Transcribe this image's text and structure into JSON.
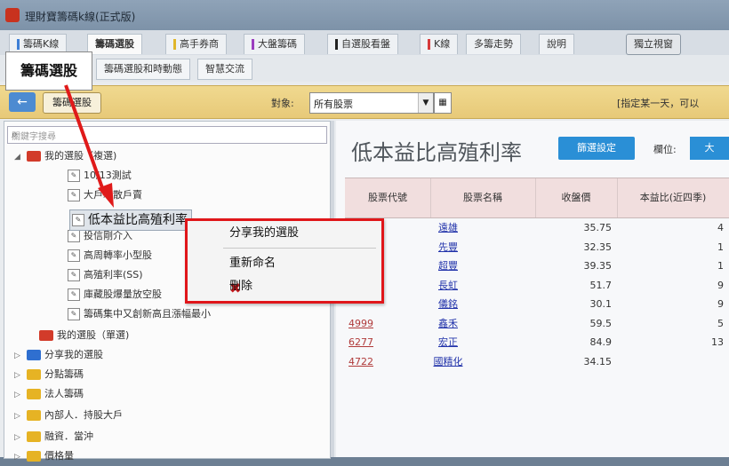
{
  "window": {
    "title": "理財寶籌碼k線(正式版)"
  },
  "tabs": [
    {
      "label": "籌碼K線",
      "mark": "#3f7fd6"
    },
    {
      "label": "籌碼選股",
      "mark": ""
    },
    {
      "label": "高手券商",
      "mark": "#e0b62a"
    },
    {
      "label": "大盤籌碼",
      "mark": "#9b3fbf"
    },
    {
      "label": "自選股看盤",
      "mark": "#222222"
    },
    {
      "label": "K線",
      "mark": "#d63a3a"
    },
    {
      "label": "多籌走勢",
      "mark": ""
    },
    {
      "label": "說明",
      "mark": ""
    },
    {
      "label": "獨立視窗",
      "mark": ""
    }
  ],
  "subtabs": [
    "籌碼選股和時動態",
    "智慧交流"
  ],
  "toolbar": {
    "back": "←",
    "stock_button": "籌碼選股",
    "object_label": "對象:",
    "object_value": "所有股票",
    "hint": "[指定某一天，可以"
  },
  "annotation": {
    "label": "籌碼選股"
  },
  "search": {
    "placeholder": "關鍵字搜尋",
    "icon": "search-icon"
  },
  "tree": [
    {
      "label": "我的選股（複選)",
      "type": "folder",
      "color": "#d23b2a",
      "arrow": "◢",
      "level": 0
    },
    {
      "label": "10/13測試",
      "type": "doc",
      "level": 1
    },
    {
      "label": "大戶增散戶賣",
      "type": "doc",
      "level": 1
    },
    {
      "label": "",
      "type": "spacer",
      "level": 1
    },
    {
      "label": "投信剛介入",
      "type": "doc",
      "level": 1
    },
    {
      "label": "高周轉率小型股",
      "type": "doc",
      "level": 1
    },
    {
      "label": "高殖利率(SS)",
      "type": "doc",
      "level": 1
    },
    {
      "label": "庫藏股爆量放空股",
      "type": "doc",
      "level": 1
    },
    {
      "label": "籌碼集中又創新高且漲幅最小",
      "type": "doc",
      "level": 1
    },
    {
      "label": "我的選股（單選)",
      "type": "folder",
      "color": "#d23b2a",
      "arrow": "",
      "level": 0
    },
    {
      "label": "分享我的選股",
      "type": "folder",
      "color": "#2f6fd0",
      "arrow": "▷",
      "level": 0
    },
    {
      "label": "分點籌碼",
      "type": "folder",
      "color": "#e6b324",
      "arrow": "▷",
      "level": 0
    },
    {
      "label": "法人籌碼",
      "type": "folder",
      "color": "#e6b324",
      "arrow": "▷",
      "level": 0
    },
    {
      "label": "內部人．持股大戶",
      "type": "folder",
      "color": "#e6b324",
      "arrow": "▷",
      "level": 0
    },
    {
      "label": "融資．當沖",
      "type": "folder",
      "color": "#e6b324",
      "arrow": "▷",
      "level": 0
    },
    {
      "label": "價格量",
      "type": "folder",
      "color": "#e6b324",
      "arrow": "▷",
      "level": 0
    }
  ],
  "selected_item": {
    "label": "低本益比高殖利率"
  },
  "context_menu": {
    "items": [
      "分享我的選股",
      "重新命名",
      "刪除"
    ]
  },
  "main": {
    "title": "低本益比高殖利率",
    "settings_button": "篩選設定",
    "unit_label": "欄位:",
    "unit_button": "大"
  },
  "table": {
    "headers": [
      "股票代號",
      "股票名稱",
      "收盤價",
      "本益比(近四季)"
    ],
    "rows": [
      {
        "code": "",
        "name": "遠雄",
        "close": "35.75",
        "pe": "4"
      },
      {
        "code": "",
        "name": "先豐",
        "close": "32.35",
        "pe": "1"
      },
      {
        "code": "",
        "name": "超豐",
        "close": "39.35",
        "pe": "1"
      },
      {
        "code": "",
        "name": "長虹",
        "close": "51.7",
        "pe": "9"
      },
      {
        "code": "",
        "name": "儀銘",
        "close": "30.1",
        "pe": "9"
      },
      {
        "code": "4999",
        "name": "鑫禾",
        "close": "59.5",
        "pe": "5"
      },
      {
        "code": "6277",
        "name": "宏正",
        "close": "84.9",
        "pe": "13"
      },
      {
        "code": "4722",
        "name": "國精化",
        "close": "34.15",
        "pe": ""
      }
    ]
  }
}
